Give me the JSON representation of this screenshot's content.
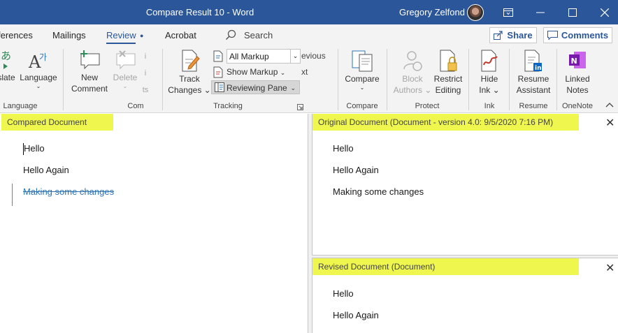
{
  "window": {
    "title": "Compare Result 10  -  Word",
    "user": "Gregory Zelfond"
  },
  "tabs": [
    {
      "label": "ferences"
    },
    {
      "label": "Mailings"
    },
    {
      "label": "Review"
    },
    {
      "label": "Acrobat"
    }
  ],
  "search": {
    "label": "Search"
  },
  "share": {
    "label": "Share"
  },
  "comments": {
    "label": "Comments"
  },
  "ribbon": {
    "language": {
      "translate_label": "slate",
      "language_line1": "Language",
      "group_label": "Language"
    },
    "comments": {
      "new_line1": "New",
      "new_line2": "Comment",
      "delete_label": "Delete",
      "group_label": "Com",
      "partial_label": "ts"
    },
    "tracking": {
      "track_line1": "Track",
      "track_line2": "Changes",
      "markup_select": "All Markup",
      "show_markup": "Show Markup",
      "reviewing_pane": "Reviewing Pane",
      "previous_partial": "evious",
      "next_partial": "xt",
      "group_label": "Tracking"
    },
    "compare": {
      "label": "Compare",
      "group_label": "Compare"
    },
    "protect": {
      "block_line1": "Block",
      "block_line2": "Authors",
      "restrict_line1": "Restrict",
      "restrict_line2": "Editing",
      "group_label": "Protect"
    },
    "ink": {
      "hide_line1": "Hide",
      "hide_line2": "Ink",
      "group_label": "Ink"
    },
    "resume": {
      "line1": "Resume",
      "line2": "Assistant",
      "group_label": "Resume"
    },
    "onenote": {
      "line1": "Linked",
      "line2": "Notes",
      "group_label": "OneNote"
    }
  },
  "panes": {
    "compared": {
      "header": "Compared Document",
      "lines": [
        "Hello",
        "Hello Again",
        "Making some changes"
      ]
    },
    "original": {
      "header": "Original Document (Document  -  version 4.0: 9/5/2020 7:16 PM)",
      "lines": [
        "Hello",
        "Hello Again",
        "Making some changes"
      ]
    },
    "revised": {
      "header": "Revised Document (Document)",
      "lines": [
        "Hello",
        "Hello Again"
      ]
    }
  },
  "colors": {
    "titlebar": "#2b579a",
    "highlight": "#eff74f",
    "deleted_text": "#2e75b6"
  }
}
